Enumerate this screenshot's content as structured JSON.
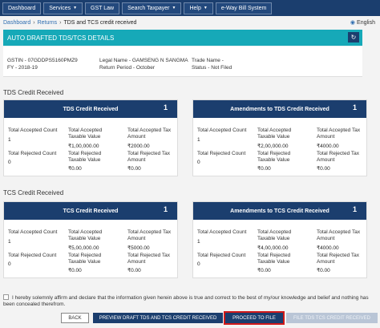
{
  "nav": {
    "items": [
      {
        "label": "Dashboard",
        "dropdown": false
      },
      {
        "label": "Services",
        "dropdown": true
      },
      {
        "label": "GST Law",
        "dropdown": false
      },
      {
        "label": "Search Taxpayer",
        "dropdown": true
      },
      {
        "label": "Help",
        "dropdown": true
      },
      {
        "label": "e-Way Bill System",
        "dropdown": false
      }
    ]
  },
  "breadcrumb": {
    "items": [
      "Dashboard",
      "Returns",
      "TDS and TCS credit received"
    ],
    "separator": "›"
  },
  "language": "English",
  "page_title": "AUTO DRAFTED TDS/TCS DETAILS",
  "info": {
    "gstin": "GSTIN - 07GDDPS5160PMZ9",
    "fy": "FY - 2018-19",
    "legal_name": "Legal Name - GAMSENG N SANGMA",
    "return_period": "Return Period - October",
    "trade_name": "Trade Name -",
    "status": "Status - Not Filed"
  },
  "tds": {
    "section_title": "TDS Credit Received",
    "received": {
      "header": "TDS Credit Received",
      "count": "1",
      "total_accepted_count_label": "Total Accepted Count",
      "total_accepted_count": "1",
      "taxable_label": "Total Accepted Taxable Value",
      "taxable": "₹1,00,000.00",
      "tax_label": "Total Accepted Tax Amount",
      "tax": "₹2000.00",
      "rejected_count_label": "Total Rejected Count",
      "rejected_count": "0",
      "rejected_taxable_label": "Total Rejected Taxable Value",
      "rejected_taxable": "₹0.00",
      "rejected_tax_label": "Total Rejected Tax Amount",
      "rejected_tax": "₹0.00"
    },
    "amendments": {
      "header": "Amendments to TDS Credit Received",
      "count": "1",
      "total_accepted_count_label": "Total Accepted Count",
      "total_accepted_count": "1",
      "taxable_label": "Total Accepted Taxable Value",
      "taxable": "₹2,00,000.00",
      "tax_label": "Total Accepted Tax Amount",
      "tax": "₹4000.00",
      "rejected_count_label": "Total Rejected Count",
      "rejected_count": "0",
      "rejected_taxable_label": "Total Rejected Taxable Value",
      "rejected_taxable": "₹0.00",
      "rejected_tax_label": "Total Rejected Tax Amount",
      "rejected_tax": "₹0.00"
    }
  },
  "tcs": {
    "section_title": "TCS Credit Received",
    "received": {
      "header": "TCS Credit Received",
      "count": "1",
      "total_accepted_count_label": "Total Accepted Count",
      "total_accepted_count": "1",
      "taxable_label": "Total Accepted Taxable Value",
      "taxable": "₹5,00,000.00",
      "tax_label": "Total Accepted Tax Amount",
      "tax": "₹5000.00",
      "rejected_count_label": "Total Rejected Count",
      "rejected_count": "0",
      "rejected_taxable_label": "Total Rejected Taxable Value",
      "rejected_taxable": "₹0.00",
      "rejected_tax_label": "Total Rejected Tax Amount",
      "rejected_tax": "₹0.00"
    },
    "amendments": {
      "header": "Amendments to TCS Credit Received",
      "count": "1",
      "total_accepted_count_label": "Total Accepted Count",
      "total_accepted_count": "1",
      "taxable_label": "Total Accepted Taxable Value",
      "taxable": "₹4,00,000.00",
      "tax_label": "Total Accepted Tax Amount",
      "tax": "₹4000.00",
      "rejected_count_label": "Total Rejected Count",
      "rejected_count": "0",
      "rejected_taxable_label": "Total Rejected Taxable Value",
      "rejected_taxable": "₹0.00",
      "rejected_tax_label": "Total Rejected Tax Amount",
      "rejected_tax": "₹0.00"
    }
  },
  "declaration": "I hereby solemnly affirm and declare that the information given herein above is true and correct to the best of my/our knowledge and belief and nothing has been concealed therefrom.",
  "buttons": {
    "back": "BACK",
    "preview": "PREVIEW DRAFT TDS AND TCS CREDIT RECEIVED",
    "proceed": "PROCEED TO FILE",
    "file": "FILE TDS TCS CREDIT RECEIVED"
  },
  "colors": {
    "nav_bg": "#1b3e6e",
    "title_bar": "#16a9b8",
    "highlight": "#d01a1a"
  }
}
